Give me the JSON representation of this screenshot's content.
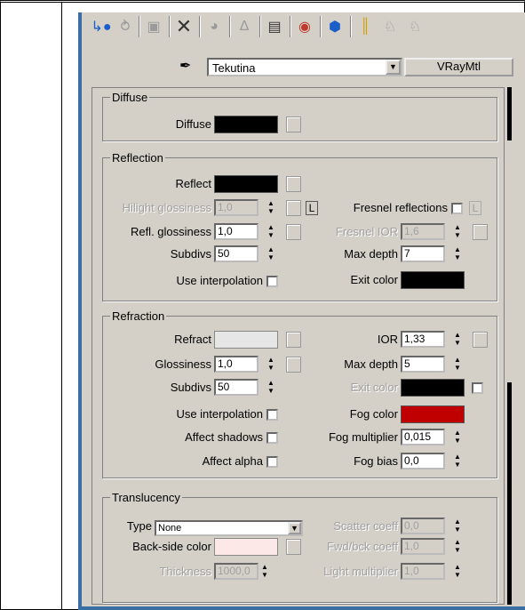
{
  "toolbar": {
    "icons": [
      "get-material-icon",
      "put-to-scene-icon",
      "assign-material-icon",
      "reset-map-icon",
      "make-copy-icon",
      "make-unique-icon",
      "put-to-library-icon",
      "material-id-icon",
      "show-map-icon",
      "show-end-result-icon",
      "go-to-parent-icon",
      "go-forward-icon"
    ]
  },
  "material": {
    "name": "Tekutina",
    "type": "VRayMtl"
  },
  "diffuse": {
    "group": "Diffuse",
    "label": "Diffuse",
    "color": "#000000"
  },
  "reflection": {
    "group": "Reflection",
    "reflect_label": "Reflect",
    "reflect_color": "#000000",
    "hilight_label": "Hilight glossiness",
    "hilight_value": "1,0",
    "l_label": "L",
    "fresnel_label": "Fresnel reflections",
    "fresnel_l": "L",
    "refl_gloss_label": "Refl. glossiness",
    "refl_gloss_value": "1,0",
    "fresnel_ior_label": "Fresnel IOR",
    "fresnel_ior_value": "1,6",
    "subdivs_label": "Subdivs",
    "subdivs_value": "50",
    "max_depth_label": "Max depth",
    "max_depth_value": "7",
    "interp_label": "Use interpolation",
    "exit_label": "Exit color",
    "exit_color": "#000000"
  },
  "refraction": {
    "group": "Refraction",
    "refract_label": "Refract",
    "refract_color": "#e6e6e6",
    "ior_label": "IOR",
    "ior_value": "1,33",
    "gloss_label": "Glossiness",
    "gloss_value": "1,0",
    "max_depth_label": "Max depth",
    "max_depth_value": "5",
    "subdivs_label": "Subdivs",
    "subdivs_value": "50",
    "exit_label": "Exit color",
    "exit_color": "#000000",
    "interp_label": "Use interpolation",
    "fog_label": "Fog color",
    "fog_color": "#c00000",
    "shadows_label": "Affect shadows",
    "fog_mult_label": "Fog multiplier",
    "fog_mult_value": "0,015",
    "alpha_label": "Affect alpha",
    "fog_bias_label": "Fog bias",
    "fog_bias_value": "0,0"
  },
  "translucency": {
    "group": "Translucency",
    "type_label": "Type",
    "type_value": "None",
    "scatter_label": "Scatter coeff",
    "scatter_value": "0,0",
    "backside_label": "Back-side color",
    "backside_color": "#fde8e8",
    "fwd_label": "Fwd/bck coeff",
    "fwd_value": "1,0",
    "thickness_label": "Thickness",
    "thickness_value": "1000,0",
    "light_label": "Light multiplier",
    "light_value": "1,0"
  }
}
